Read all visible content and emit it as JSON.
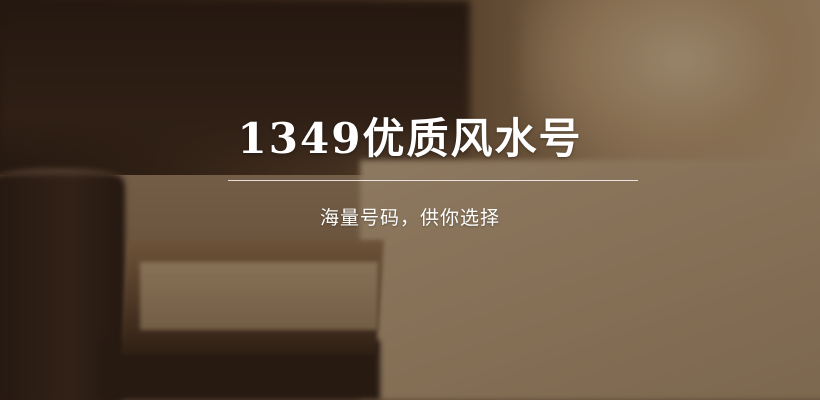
{
  "banner": {
    "title": "1349优质风水号",
    "subtitle": "海量号码，供你选择"
  },
  "colors": {
    "text": "#ffffff",
    "divider": "#ffffff",
    "overlay": "#1e140e"
  }
}
